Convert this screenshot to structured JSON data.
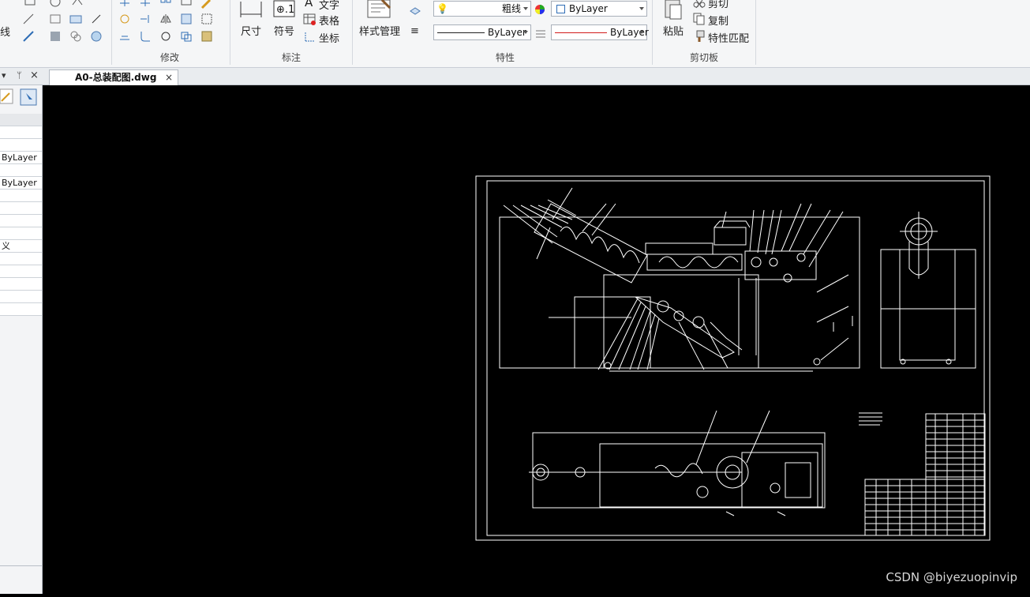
{
  "ribbon": {
    "left_edge_label": "线",
    "size_label": "尺寸",
    "symbol_label": "符号",
    "text_label": "文字",
    "table_label": "表格",
    "coord_label": "坐标",
    "style_mgr_label": "样式管理",
    "lineweight_value": "粗线",
    "color_value": "ByLayer",
    "linetype_value": "ByLayer",
    "lineweight2_value": "ByLayer",
    "paste_label": "粘贴",
    "cut_label": "剪切",
    "copy_label": "复制",
    "matchprop_label": "特性匹配",
    "groups": {
      "modify": "修改",
      "annotate": "标注",
      "properties": "特性",
      "clipboard": "剪切板"
    }
  },
  "tab": {
    "title": "A0-总装配图.dwg",
    "close": "×"
  },
  "left_panel": {
    "header_icons": [
      "▾",
      "ᛘ",
      "×"
    ],
    "rows": [
      "ByLayer",
      "ByLayer",
      "义"
    ]
  },
  "watermark": "CSDN @biyezuopinvip",
  "colors": {
    "canvas_bg": "#000000",
    "drawing_line": "#ffffff",
    "linetype_red": "#d21c1c"
  }
}
